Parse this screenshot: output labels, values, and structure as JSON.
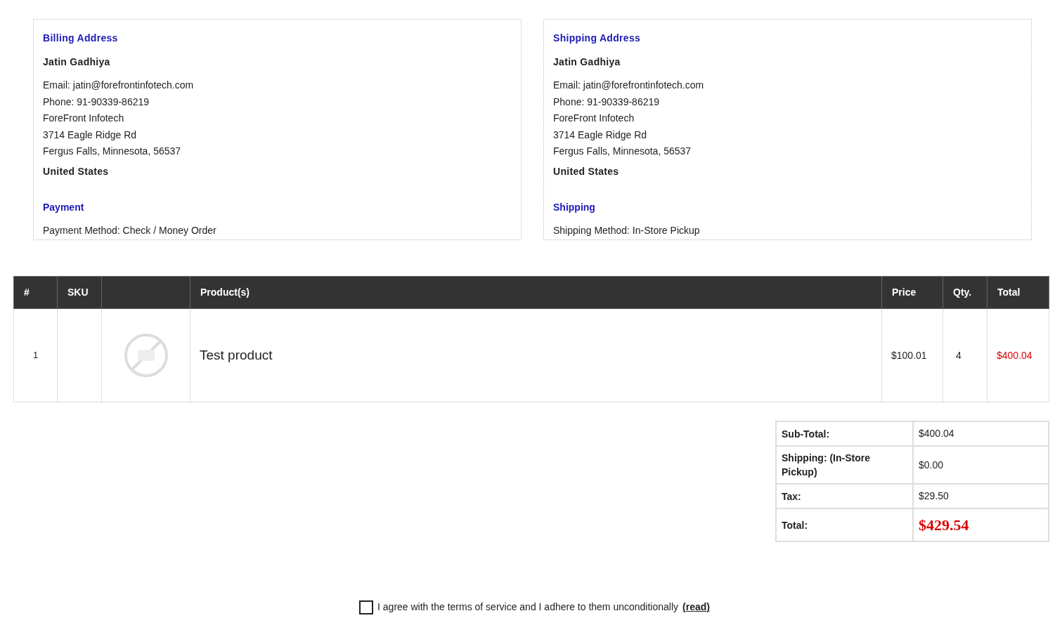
{
  "address_cards": [
    {
      "title": "Billing Address",
      "name": "Jatin Gadhiya",
      "lines": [
        "Email: jatin@forefrontinfotech.com",
        "Phone: 91-90339-86219",
        "ForeFront Infotech",
        "3714 Eagle Ridge Rd",
        "Fergus Falls, Minnesota, 56537"
      ],
      "country": "United States",
      "method_title": "Payment",
      "method": "Payment Method: Check / Money Order"
    },
    {
      "title": "Shipping Address",
      "name": "Jatin Gadhiya",
      "lines": [
        "Email: jatin@forefrontinfotech.com",
        "Phone: 91-90339-86219",
        "ForeFront Infotech",
        "3714 Eagle Ridge Rd",
        "Fergus Falls, Minnesota, 56537"
      ],
      "country": "United States",
      "method_title": "Shipping",
      "method": "Shipping Method: In-Store Pickup"
    }
  ],
  "products_table": {
    "columns": [
      "#",
      "SKU",
      "",
      "Product(s)",
      "Price",
      "Qty.",
      "Total"
    ],
    "rows": [
      {
        "number": "1",
        "sku": "",
        "product": "Test product",
        "price": "$100.01",
        "qty": "4",
        "total": "$400.04"
      }
    ]
  },
  "totals": [
    {
      "label": "Sub-Total:",
      "value": "$400.04",
      "kind": "line"
    },
    {
      "label": "Shipping: (In-Store Pickup)",
      "value": "$0.00",
      "kind": "line"
    },
    {
      "label": "Tax:",
      "value": "$29.50",
      "kind": "line"
    },
    {
      "label": "Total:",
      "value": "$429.54",
      "kind": "grand"
    }
  ],
  "terms": {
    "checked": false,
    "text": "I agree with the terms of service and I adhere to them unconditionally",
    "link": "(read)"
  }
}
